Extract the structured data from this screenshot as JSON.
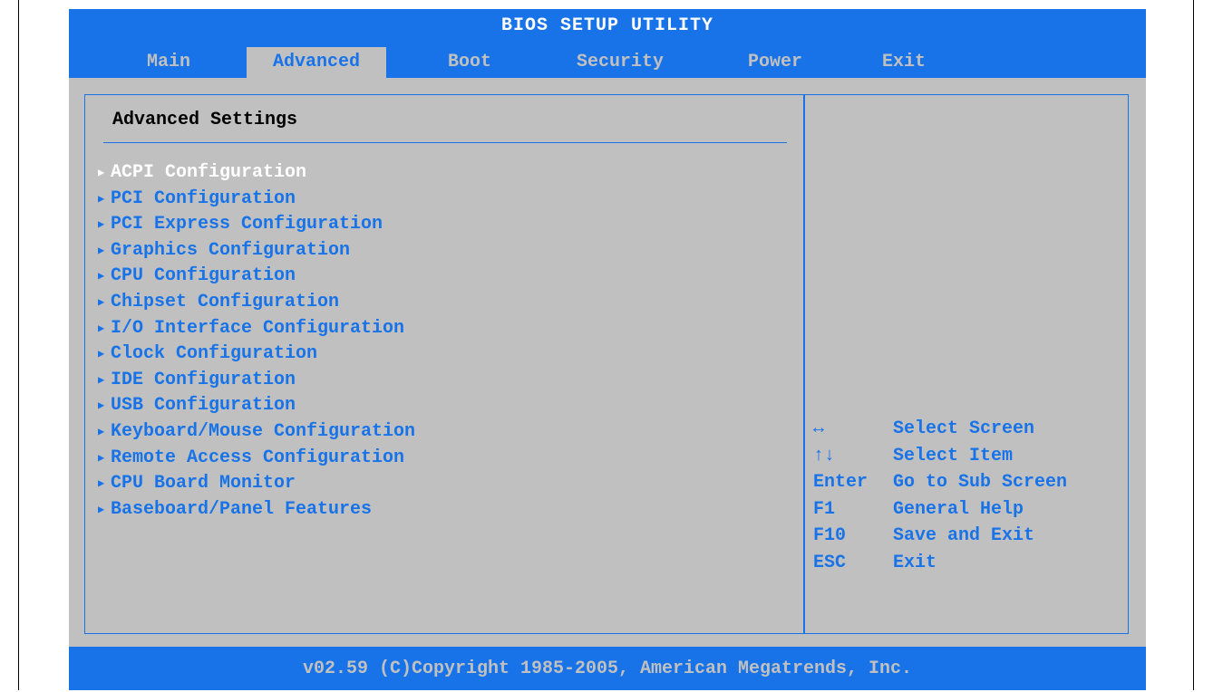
{
  "window": {
    "title": "BIOS SETUP UTILITY"
  },
  "tabs": [
    {
      "label": "Main"
    },
    {
      "label": "Advanced",
      "active": true
    },
    {
      "label": "Boot"
    },
    {
      "label": "Security"
    },
    {
      "label": "Power"
    },
    {
      "label": "Exit"
    }
  ],
  "main": {
    "section_title": "Advanced Settings",
    "arrow_icon": "right-triangle-icon",
    "selected_index": 0,
    "items": [
      {
        "label": "ACPI Configuration"
      },
      {
        "label": "PCI Configuration"
      },
      {
        "label": "PCI Express Configuration"
      },
      {
        "label": "Graphics Configuration"
      },
      {
        "label": "CPU Configuration"
      },
      {
        "label": "Chipset Configuration"
      },
      {
        "label": "I/O Interface Configuration"
      },
      {
        "label": "Clock Configuration"
      },
      {
        "label": "IDE Configuration"
      },
      {
        "label": "USB Configuration"
      },
      {
        "label": "Keyboard/Mouse Configuration"
      },
      {
        "label": "Remote Access Configuration"
      },
      {
        "label": "CPU Board Monitor"
      },
      {
        "label": "Baseboard/Panel Features"
      }
    ]
  },
  "help": [
    {
      "key": "↔",
      "action": "Select Screen"
    },
    {
      "key": "↑↓",
      "action": "Select Item"
    },
    {
      "key": "Enter",
      "action": "Go to Sub Screen"
    },
    {
      "key": "F1",
      "action": "General Help"
    },
    {
      "key": "F10",
      "action": "Save and Exit"
    },
    {
      "key": "ESC",
      "action": "Exit"
    }
  ],
  "footer": {
    "text": "v02.59 (C)Copyright 1985-2005, American Megatrends, Inc."
  },
  "colors": {
    "accent": "#1873e8",
    "background": "#c0c0c0",
    "selected_text": "#ffffff",
    "title_text": "#000000"
  }
}
